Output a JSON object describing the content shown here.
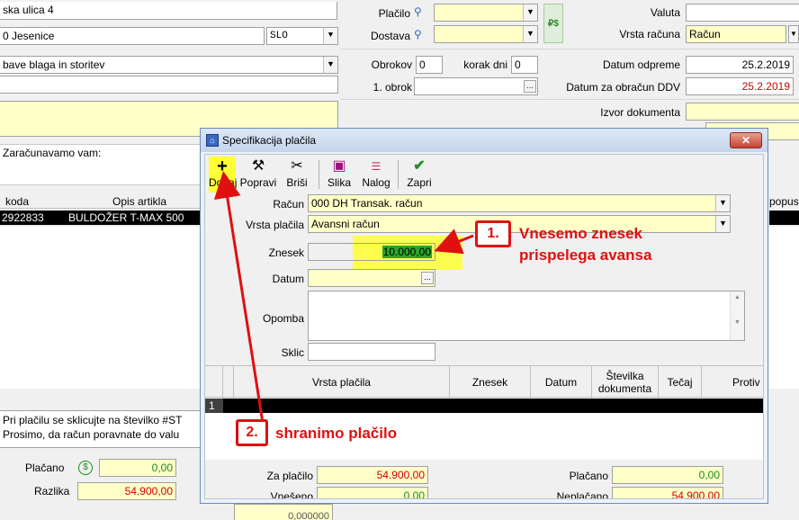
{
  "bg": {
    "address": "ska ulica 4",
    "city": "0 Jesenice",
    "country": "SLO",
    "doc_type": "bave blaga in storitev",
    "placilo_label": "Plačilo",
    "dostava_label": "Dostava",
    "valuta_label": "Valuta",
    "vrsta_racuna_label": "Vrsta računa",
    "vrsta_racuna_value": "Račun",
    "obrokov_label": "Obrokov",
    "obrokov_value": "0",
    "korak_dni_label": "korak dni",
    "korak_dni_value": "0",
    "datum_odpreme_label": "Datum odpreme",
    "datum_odpreme_value": "25.2.2019",
    "prvi_obrok_label": "1. obrok",
    "datum_ddv_label": "Datum za obračun DDV",
    "datum_ddv_value": "25.2.2019",
    "izvor_label": "Izvor dokumenta",
    "zaracunavamo": "Zaračunavamo vam:",
    "col_koda": "koda",
    "col_opis": "Opis artikla",
    "col_opust": "popust",
    "row_koda": "2922833",
    "row_opis": "BULDOŽER T-MAX 500",
    "note_line1": "Pri plačilu se sklicujte na številko #ST",
    "note_line2": "Prosimo, da račun poravnate do valu",
    "placano_label": "Plačano",
    "placano_value": "0,00",
    "razlika_label": "Razlika",
    "razlika_value": "54.900,00",
    "bottom_value": "0,000000",
    "currency_icon": "$"
  },
  "dialog": {
    "title": "Specifikacija plačila",
    "toolbar": {
      "dodaj": "Dodaj",
      "popravi": "Popravi",
      "brisi": "Briši",
      "slika": "Slika",
      "nalog": "Nalog",
      "zapri": "Zapri"
    },
    "racun_label": "Račun",
    "racun_value": "000  DH Transak. račun",
    "vrsta_placila_label": "Vrsta plačila",
    "vrsta_placila_value": "Avansni račun",
    "znesek_label": "Znesek",
    "znesek_value": "10.000,00",
    "datum_label": "Datum",
    "opomba_label": "Opomba",
    "sklic_label": "Sklic",
    "grid_headers": {
      "vrsta_placila": "Vrsta plačila",
      "znesek": "Znesek",
      "datum": "Datum",
      "stevilka_line1": "Številka",
      "stevilka_line2": "dokumenta",
      "tecaj": "Tečaj",
      "protiv": "Protiv"
    },
    "grid_row_number": "1",
    "za_placilo_label": "Za plačilo",
    "za_placilo_value": "54.900,00",
    "placano_label": "Plačano",
    "placano_value": "0,00",
    "vneseno_label": "Vnešeno",
    "vneseno_value": "0,00",
    "neplacano_label": "Neplačano",
    "neplacano_value": "54.900,00"
  },
  "annotations": {
    "callout1_num": "1.",
    "callout1_line1": "Vnesemo znesek",
    "callout1_line2": "prispelega avansa",
    "callout2_num": "2.",
    "callout2_text": "shranimo plačilo"
  },
  "colors": {
    "accent_red": "#e01010",
    "highlight_yellow": "#ffff33",
    "field_yellow": "#ffffc8"
  }
}
